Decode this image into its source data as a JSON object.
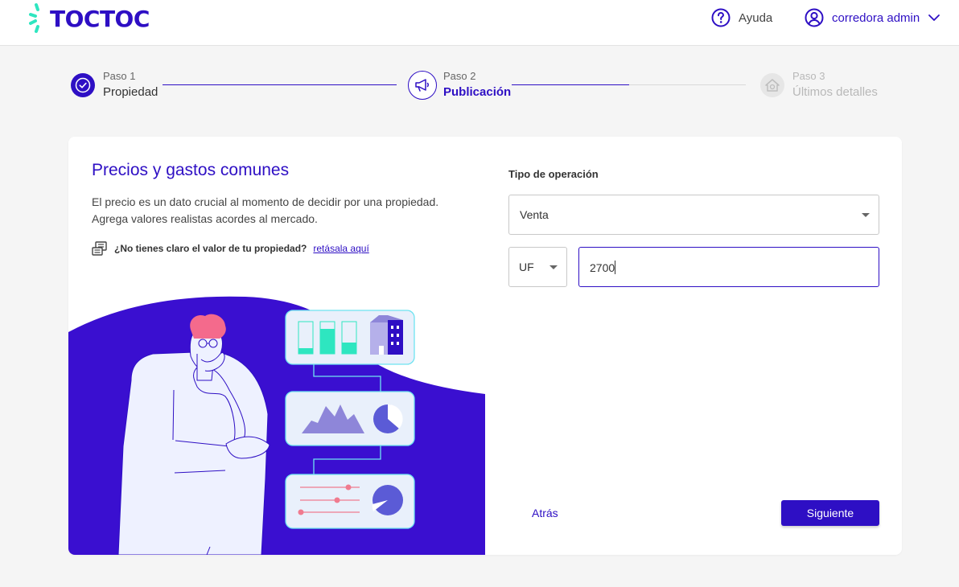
{
  "header": {
    "logo_text": "TOCTOC",
    "help_label": "Ayuda",
    "user_label": "corredora admin"
  },
  "stepper": {
    "steps": [
      {
        "number": "Paso 1",
        "name": "Propiedad",
        "state": "completed"
      },
      {
        "number": "Paso 2",
        "name": "Publicación",
        "state": "active"
      },
      {
        "number": "Paso 3",
        "name": "Últimos detalles",
        "state": "pending"
      }
    ],
    "progress": {
      "line_1": 1.0,
      "line_2": 0.5
    }
  },
  "section": {
    "title": "Precios y gastos comunes",
    "description_line1": "El precio es un dato crucial al momento de decidir por una propiedad.",
    "description_line2": "Agrega valores realistas acordes al mercado.",
    "hint_question": "¿No tienes claro el valor de tu propiedad?",
    "hint_link": "retásala aquí"
  },
  "form": {
    "operation_label": "Tipo de operación",
    "operation_value": "Venta",
    "currency_value": "UF",
    "price_value": "2700"
  },
  "actions": {
    "back_label": "Atrás",
    "next_label": "Siguiente"
  },
  "colors": {
    "brand": "#2e0fc4",
    "accent": "#2ee6c0",
    "illustration_bg": "#3a0fd0"
  }
}
